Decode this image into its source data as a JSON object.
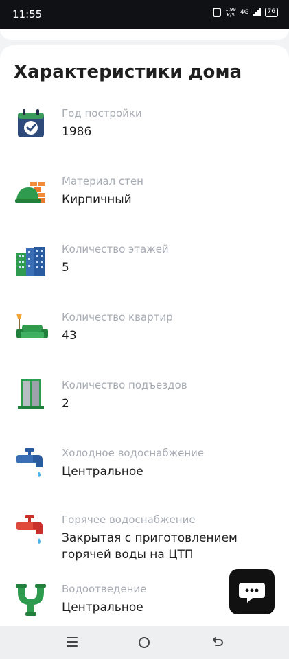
{
  "status_bar": {
    "time": "11:55",
    "net_speed_value": "1,99",
    "net_speed_unit": "K/S",
    "network": "4G",
    "battery": "76"
  },
  "section": {
    "title": "Характеристики дома"
  },
  "characteristics": [
    {
      "icon": "calendar-check-icon",
      "label": "Год постройки",
      "value": "1986"
    },
    {
      "icon": "hardhat-bricks-icon",
      "label": "Материал стен",
      "value": "Кирпичный"
    },
    {
      "icon": "buildings-icon",
      "label": "Количество этажей",
      "value": "5"
    },
    {
      "icon": "sofa-lamp-icon",
      "label": "Количество квартир",
      "value": "43"
    },
    {
      "icon": "elevator-door-icon",
      "label": "Количество подъездов",
      "value": "2"
    },
    {
      "icon": "cold-water-tap-icon",
      "label": "Холодное водоснабжение",
      "value": "Центральное"
    },
    {
      "icon": "hot-water-tap-icon",
      "label": "Горячее водоснабжение",
      "value": "Закрытая с приготовлением горячей воды на ЦТП"
    },
    {
      "icon": "drain-pipe-icon",
      "label": "Водоотведение",
      "value": "Центральное"
    }
  ],
  "chat": {
    "icon": "chat-bubble-icon"
  },
  "nav": {
    "menu_icon": "menu-icon",
    "home_icon": "home-circle-icon",
    "back_icon": "back-icon"
  }
}
